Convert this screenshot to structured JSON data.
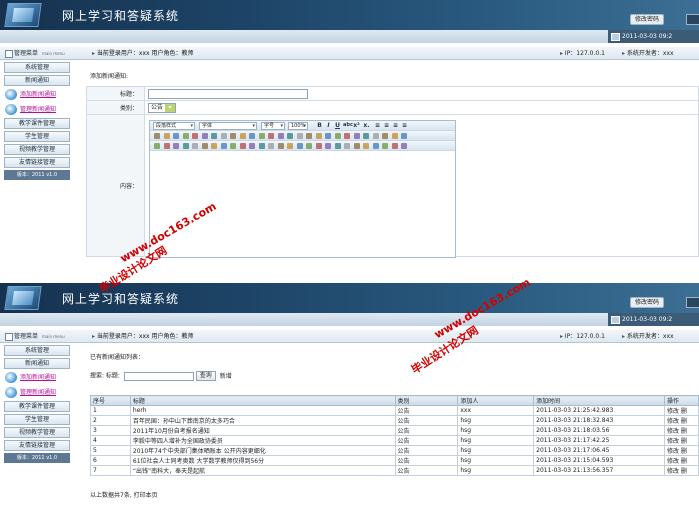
{
  "app": {
    "title": "网上学习和答疑系统",
    "change_password": "修改密码",
    "datetime": "2011-03-03 09:2"
  },
  "login": {
    "menu_head": "管理菜单",
    "menu_head_en": "main menu",
    "crumb": "当前登录用户：xxx  用户角色：教师",
    "ip": "IP：127.0.0.1",
    "developer": "系统开发者：xxx"
  },
  "sidebar1": {
    "items": [
      "系统管理",
      "新闻通知"
    ],
    "special": [
      "添加新闻通知",
      "管理新闻通知"
    ],
    "items2": [
      "教学课件管理",
      "学生管理",
      "视频教学管理",
      "友情链接管理"
    ],
    "version": "版本：2011 v1.0"
  },
  "sidebar2": {
    "items": [
      "系统管理",
      "新闻通知"
    ],
    "special": [
      "添加新闻通知",
      "管理新闻通知"
    ],
    "items2": [
      "教学课件管理",
      "学生管理",
      "视频教学管理",
      "友情链接管理"
    ],
    "version": "版本：2011 v1.0"
  },
  "add_form": {
    "heading": "添加新闻通知:",
    "title_label": "标题：",
    "category_label": "类别：",
    "category_value": "公告",
    "content_label": "内容：",
    "editor": {
      "paragraph_style": "段落样式",
      "font": "字体",
      "font_size": "字号",
      "zoom": "100%"
    }
  },
  "list_page": {
    "heading": "已有新闻通知列表：",
    "search_label": "搜索: 标题:",
    "search_button": "查询",
    "add_link": "新增",
    "columns": [
      "序号",
      "标题",
      "类别",
      "添加人",
      "添加时间",
      "操作"
    ],
    "rows": [
      [
        "1",
        "herh",
        "公告",
        "xxx",
        "2011-03-03 21:25:42.983",
        "修改 删"
      ],
      [
        "2",
        "百年民国：孙中山下葬南京的太多巧合",
        "公告",
        "hsg",
        "2011-03-03 21:18:32.843",
        "修改 删"
      ],
      [
        "3",
        "2011年10月份自考报名通知",
        "公告",
        "hsg",
        "2011-03-03 21:18:03.56",
        "修改 删"
      ],
      [
        "4",
        "李毅中等四人增补为全国政协委员",
        "公告",
        "hsg",
        "2011-03-03 21:17:42.25",
        "修改 删"
      ],
      [
        "5",
        "2010年74个中央部门集体晒账本 公开内容更细化",
        "公告",
        "hsg",
        "2011-03-03 21:17:06.45",
        "修改 删"
      ],
      [
        "6",
        "61位社会人士同考奥数 大学数学教师仅得到56分",
        "公告",
        "hsg",
        "2011-03-03 21:15:04.593",
        "修改 删"
      ],
      [
        "7",
        "“出钱”南科大，奉天是起航",
        "公告",
        "hsg",
        "2011-03-03 21:13:56.357",
        "修改 删"
      ]
    ],
    "footer": "以上数据共7条, 打印本页"
  },
  "watermarks": {
    "site": "www.doc163.com",
    "name": "毕业设计论文网"
  }
}
